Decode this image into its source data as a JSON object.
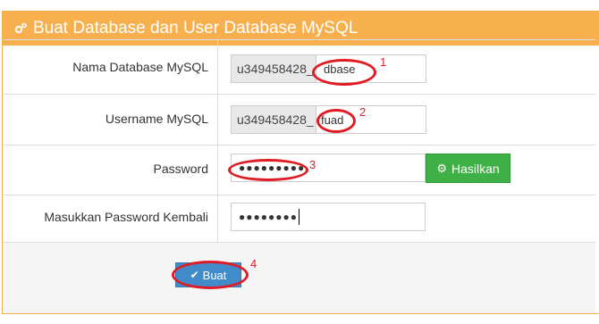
{
  "panel": {
    "title": "Buat Database dan User Database MySQL",
    "title_icon": "cogs-icon",
    "header_color": "#f8b04f"
  },
  "form": {
    "db_name": {
      "label": "Nama Database MySQL",
      "prefix": "u349458428_",
      "value": "dbase"
    },
    "username": {
      "label": "Username MySQL",
      "prefix": "u349458428_",
      "value": "fuad"
    },
    "password": {
      "label": "Password",
      "value": "●●●●●●●●●"
    },
    "password_confirm": {
      "label": "Masukkan Password Kembali",
      "value": "●●●●●●●●"
    },
    "generate_button": {
      "label": "Hasilkan",
      "icon": "gear-icon",
      "color": "#3fb045"
    },
    "submit_button": {
      "label": "Buat",
      "icon": "check-icon",
      "color": "#428bca"
    }
  },
  "annotations": {
    "color": "#e01b24",
    "labels": [
      "1",
      "2",
      "3",
      "4"
    ]
  }
}
